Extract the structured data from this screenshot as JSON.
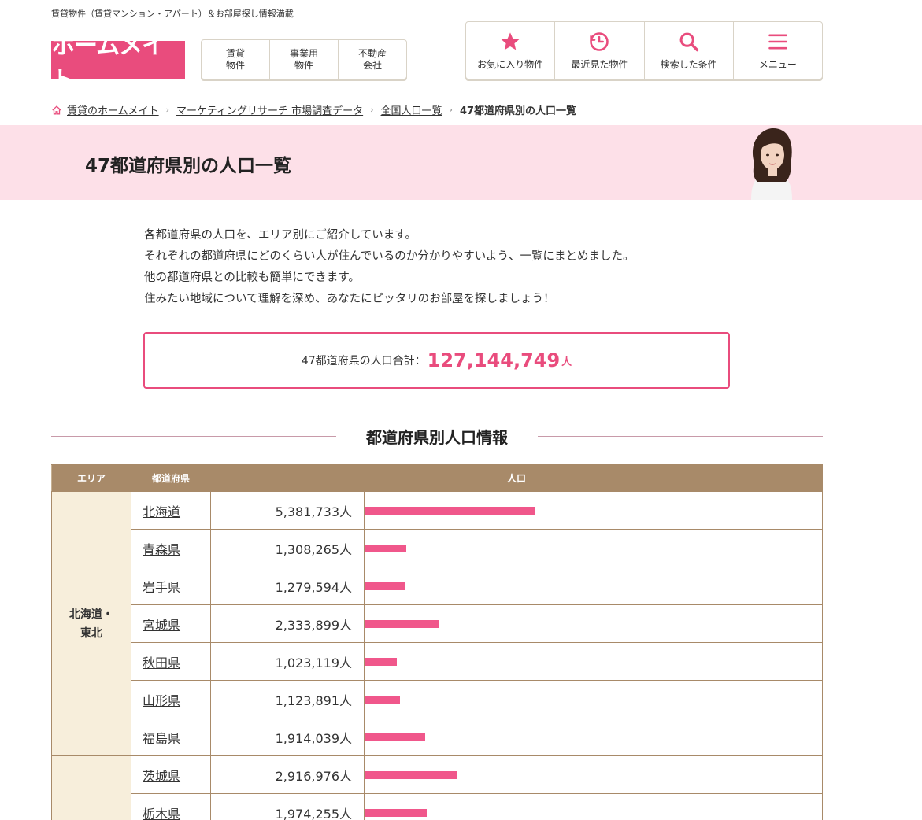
{
  "header": {
    "tagline": "賃貸物件（賃貸マンション・アパート）＆お部屋探し情報満載",
    "logo_text": "ホームメイト",
    "categories": [
      {
        "label": "賃貸\n物件"
      },
      {
        "label": "事業用\n物件"
      },
      {
        "label": "不動産\n会社"
      }
    ],
    "utilities": [
      {
        "label": "お気に入り物件",
        "icon": "star-icon"
      },
      {
        "label": "最近見た物件",
        "icon": "history-icon"
      },
      {
        "label": "検索した条件",
        "icon": "search-icon"
      },
      {
        "label": "メニュー",
        "icon": "hamburger-menu-icon"
      }
    ]
  },
  "breadcrumb": {
    "items": [
      "賃貸のホームメイト",
      "マーケティングリサーチ 市場調査データ",
      "全国人口一覧"
    ],
    "current": "47都道府県別の人口一覧"
  },
  "hero": {
    "title": "47都道府県別の人口一覧"
  },
  "intro": {
    "lines": [
      "各都道府県の人口を、エリア別にご紹介しています。",
      "それぞれの都道府県にどのくらい人が住んでいるのか分かりやすいよう、一覧にまとめました。",
      "他の都道府県との比較も簡単にできます。",
      "住みたい地域について理解を深め、あなたにピッタリのお部屋を探しましょう！"
    ]
  },
  "total": {
    "label": "47都道府県の人口合計：",
    "value": "127,144,749",
    "unit": "人"
  },
  "section": {
    "title": "都道府県別人口情報"
  },
  "table": {
    "headers": [
      "エリア",
      "都道府県",
      "人口"
    ],
    "bar_max_population": 13000000,
    "groups": [
      {
        "area_lines": [
          "北海道・",
          "東北"
        ],
        "rows": [
          {
            "pref": "北海道",
            "pop_text": "5,381,733人",
            "pop": 5381733
          },
          {
            "pref": "青森県",
            "pop_text": "1,308,265人",
            "pop": 1308265
          },
          {
            "pref": "岩手県",
            "pop_text": "1,279,594人",
            "pop": 1279594
          },
          {
            "pref": "宮城県",
            "pop_text": "2,333,899人",
            "pop": 2333899
          },
          {
            "pref": "秋田県",
            "pop_text": "1,023,119人",
            "pop": 1023119
          },
          {
            "pref": "山形県",
            "pop_text": "1,123,891人",
            "pop": 1123891
          },
          {
            "pref": "福島県",
            "pop_text": "1,914,039人",
            "pop": 1914039
          }
        ]
      },
      {
        "area_lines": [],
        "rows": [
          {
            "pref": "茨城県",
            "pop_text": "2,916,976人",
            "pop": 2916976
          },
          {
            "pref": "栃木県",
            "pop_text": "1,974,255人",
            "pop": 1974255
          }
        ]
      }
    ]
  },
  "colors": {
    "brand_pink": "#e94c7d",
    "bar_pink": "#f0578b",
    "table_header": "#a88a69",
    "area_bg": "#f7eedb",
    "hero_bg": "#fde0e8"
  }
}
